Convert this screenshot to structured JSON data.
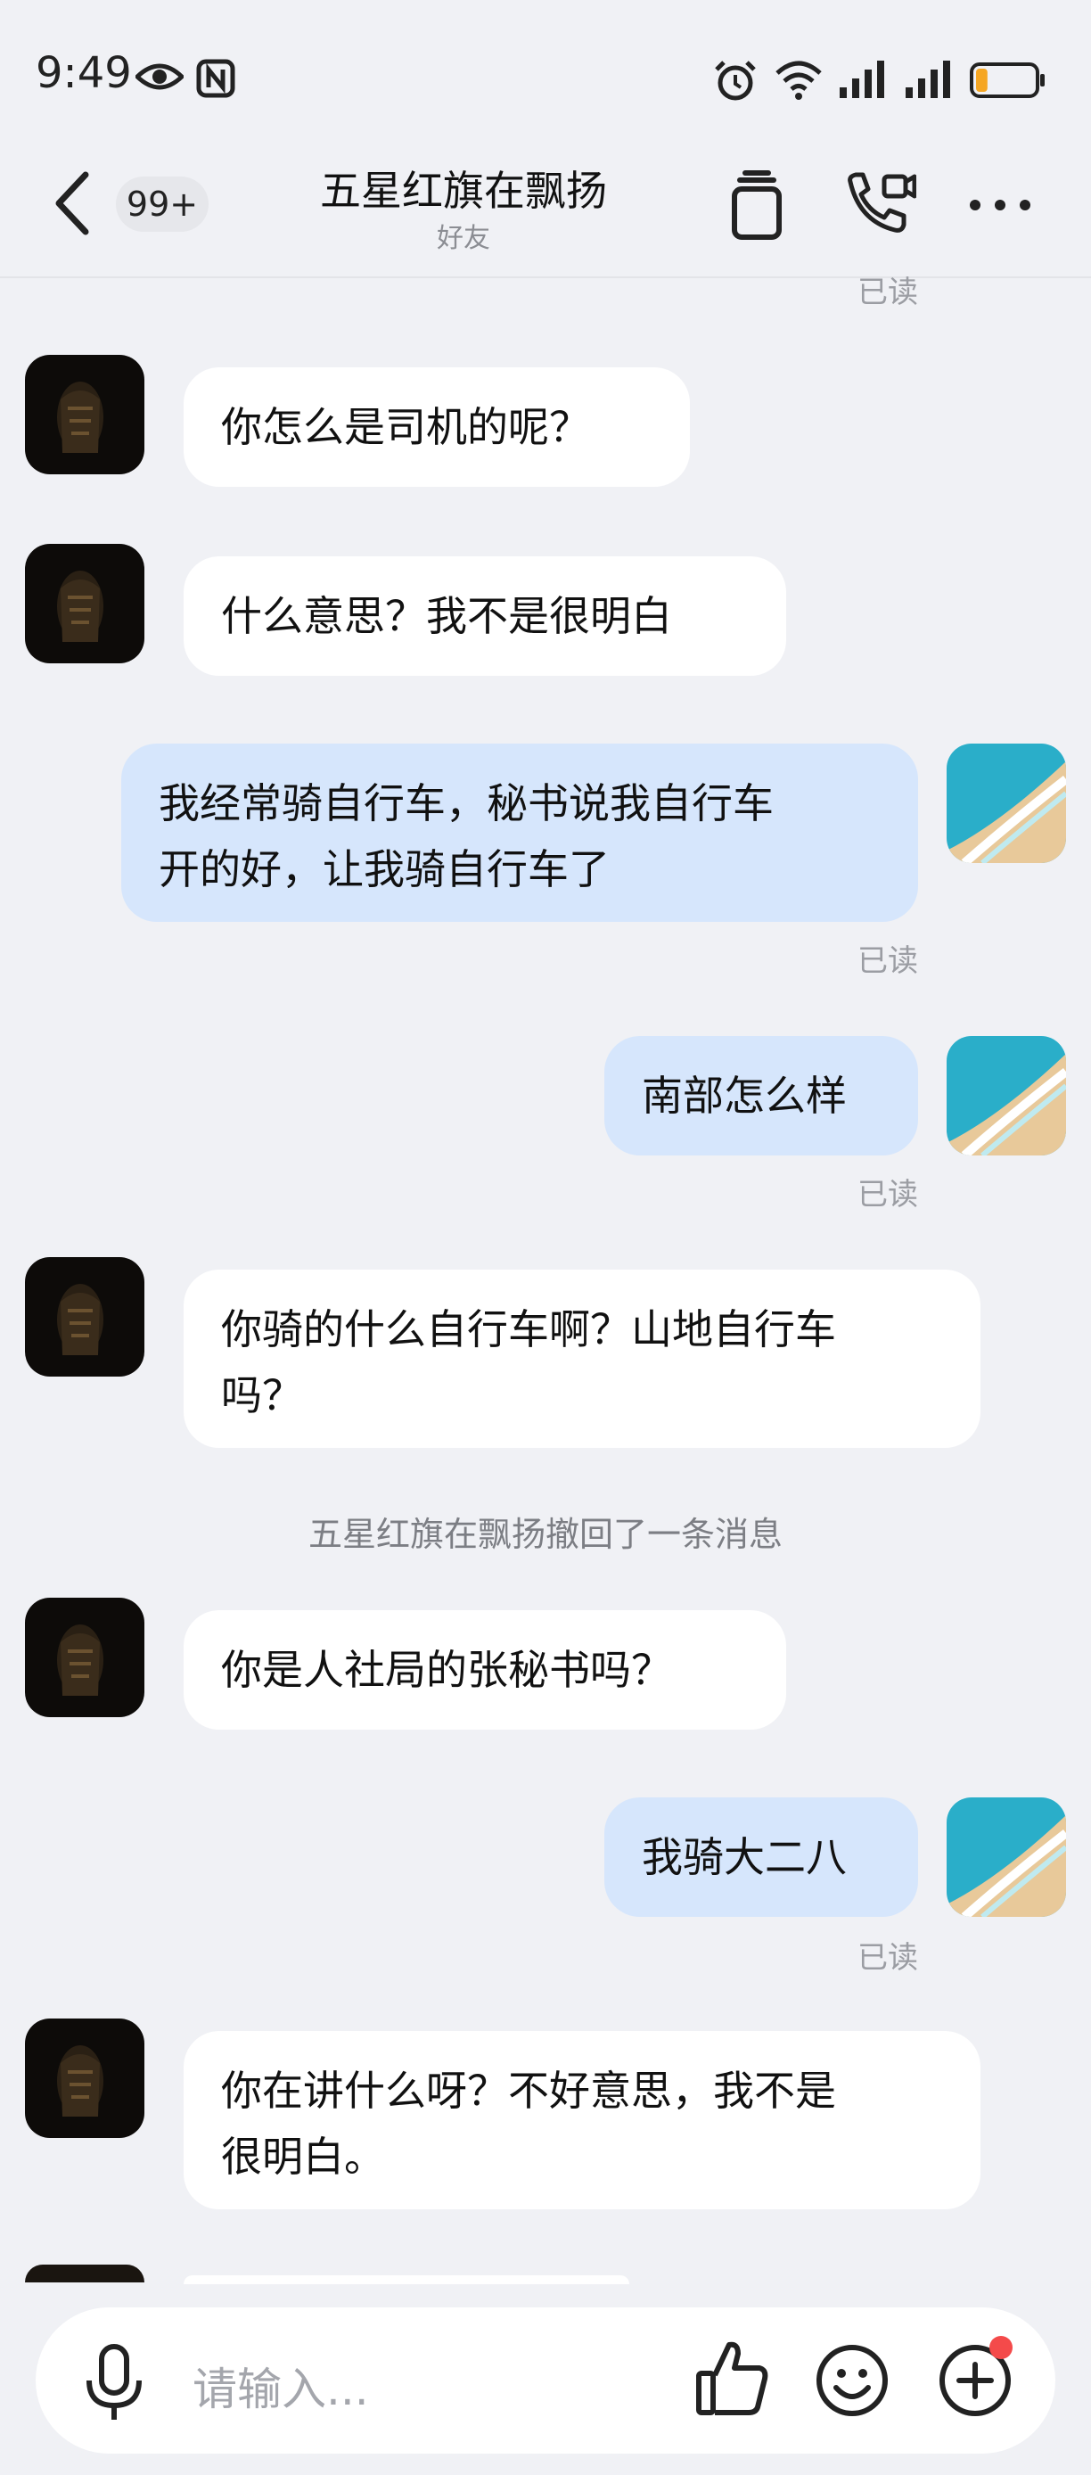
{
  "status_bar": {
    "time": "9:49",
    "icons": [
      "eye-icon",
      "nfc-icon",
      "alarm-icon",
      "wifi-icon",
      "signal-icon",
      "signal-icon",
      "battery-icon"
    ],
    "battery_level": 0.2,
    "battery_color": "#f5a623"
  },
  "header": {
    "unread_badge": "99+",
    "title": "五星红旗在飘扬",
    "subtitle": "好友"
  },
  "messages": {
    "top_read": "已读",
    "m1": "你怎么是司机的呢？",
    "m2": "什么意思？我不是很明白",
    "m3_line1": "我经常骑自行车，秘书说我自行车",
    "m3_line2": "开的好，让我骑自行车了",
    "m3_read": "已读",
    "m4": "南部怎么样",
    "m4_read": "已读",
    "m5_line1": "你骑的什么自行车啊？山地自行车",
    "m5_line2": "吗？",
    "system_notice": "五星红旗在飘扬撤回了一条消息",
    "m6": "你是人社局的张秘书吗？",
    "m7": "我骑大二八",
    "m7_read": "已读",
    "m8_line1": "你在讲什么呀？不好意思，我不是",
    "m8_line2": "很明白。"
  },
  "input_bar": {
    "placeholder": "请输入..."
  },
  "colors": {
    "outgoing_bubble": "#d6e6fc",
    "incoming_bubble": "#ffffff",
    "background": "#f0f1f5",
    "notification_dot": "#f44a4a"
  }
}
